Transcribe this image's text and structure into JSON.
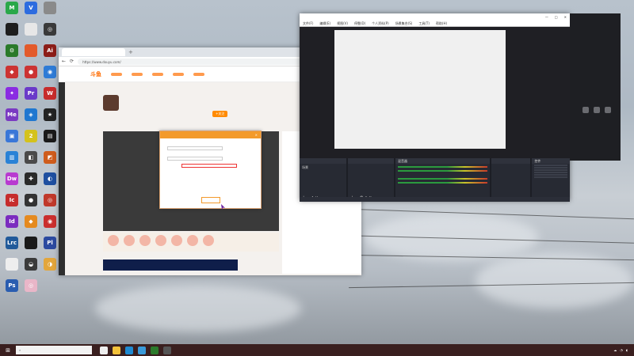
{
  "desktop_icons": [
    {
      "label": "",
      "color": "#2aa84a",
      "glyph": "M"
    },
    {
      "label": "",
      "color": "#2d6cdf",
      "glyph": "V"
    },
    {
      "label": "",
      "color": "#8a8a8a",
      "glyph": ""
    },
    {
      "label": "",
      "color": "#1e1e1e",
      "glyph": ""
    },
    {
      "label": "",
      "color": "#e7e7e7",
      "glyph": ""
    },
    {
      "label": "",
      "color": "#3a3a3a",
      "glyph": "◎"
    },
    {
      "label": "",
      "color": "#2a7a2a",
      "glyph": "⚙"
    },
    {
      "label": "",
      "color": "#e35a2b",
      "glyph": ""
    },
    {
      "label": "",
      "color": "#8c1d18",
      "glyph": "Ai"
    },
    {
      "label": "",
      "color": "#c33",
      "glyph": "◆"
    },
    {
      "label": "",
      "color": "#cc3333",
      "glyph": "●"
    },
    {
      "label": "",
      "color": "#2e7bd6",
      "glyph": "◉"
    },
    {
      "label": "",
      "color": "#8a2be2",
      "glyph": "✦"
    },
    {
      "label": "",
      "color": "#6a3ac9",
      "glyph": "Pr"
    },
    {
      "label": "",
      "color": "#c72c2c",
      "glyph": "W"
    },
    {
      "label": "",
      "color": "#7a3ac2",
      "glyph": "Me"
    },
    {
      "label": "",
      "color": "#1f77d0",
      "glyph": "◈"
    },
    {
      "label": "",
      "color": "#222",
      "glyph": "★"
    },
    {
      "label": "",
      "color": "#3a77d8",
      "glyph": "▣"
    },
    {
      "label": "",
      "color": "#d4c21c",
      "glyph": "2"
    },
    {
      "label": "",
      "color": "#1a1a1a",
      "glyph": "▤"
    },
    {
      "label": "",
      "color": "#2a82d6",
      "glyph": "▥"
    },
    {
      "label": "",
      "color": "#4a4a4a",
      "glyph": "◧"
    },
    {
      "label": "",
      "color": "#cf5c1c",
      "glyph": "◩"
    },
    {
      "label": "",
      "color": "#b83ad0",
      "glyph": "Dw"
    },
    {
      "label": "",
      "color": "#2a2a2a",
      "glyph": "✚"
    },
    {
      "label": "",
      "color": "#1f4fa0",
      "glyph": "◐"
    },
    {
      "label": "",
      "color": "#c62d2d",
      "glyph": "Ic"
    },
    {
      "label": "",
      "color": "#333",
      "glyph": "●"
    },
    {
      "label": "",
      "color": "#c0392b",
      "glyph": "◎"
    },
    {
      "label": "",
      "color": "#7b2cbf",
      "glyph": "Id"
    },
    {
      "label": "",
      "color": "#e58a1f",
      "glyph": "◆"
    },
    {
      "label": "",
      "color": "#ca2e2e",
      "glyph": "◉"
    },
    {
      "label": "",
      "color": "#215a9a",
      "glyph": "Lrc"
    },
    {
      "label": "",
      "color": "#1a1a1a",
      "glyph": ""
    },
    {
      "label": "",
      "color": "#2c4aa0",
      "glyph": "Pl"
    },
    {
      "label": "",
      "color": "#eee",
      "glyph": ""
    },
    {
      "label": "",
      "color": "#3a3a3a",
      "glyph": "◒"
    },
    {
      "label": "",
      "color": "#e3a63c",
      "glyph": "◑"
    },
    {
      "label": "",
      "color": "#2a5db0",
      "glyph": "Ps"
    },
    {
      "label": "",
      "color": "#e9b6c8",
      "glyph": "◎"
    }
  ],
  "browser": {
    "tab_title": "",
    "url": "https://www.douyu.com/",
    "logo": "斗鱼",
    "streamer_title": "",
    "streamer_sub": "",
    "follow": "+关注"
  },
  "dialog": {
    "title": "",
    "close": "×",
    "row1_label": "",
    "row1_value": "",
    "row2_label": "",
    "row2_value": "",
    "row3_value": "",
    "note": "",
    "button": ""
  },
  "obs": {
    "title": "",
    "menu": [
      "文件(F)",
      "编辑(E)",
      "视图(V)",
      "停靠(D)",
      "个人资料(P)",
      "场景集合(S)",
      "工具(T)",
      "帮助(H)"
    ],
    "docks": {
      "scenes_title": "",
      "scene_item": "场景",
      "sources_title": "",
      "mixer_title": "混音器",
      "transitions_title": "",
      "controls_title": "控件"
    },
    "controls": [
      "",
      "",
      "",
      "",
      "",
      ""
    ],
    "status": ""
  },
  "taskbar": {
    "search_placeholder": "",
    "time": "",
    "date": ""
  }
}
